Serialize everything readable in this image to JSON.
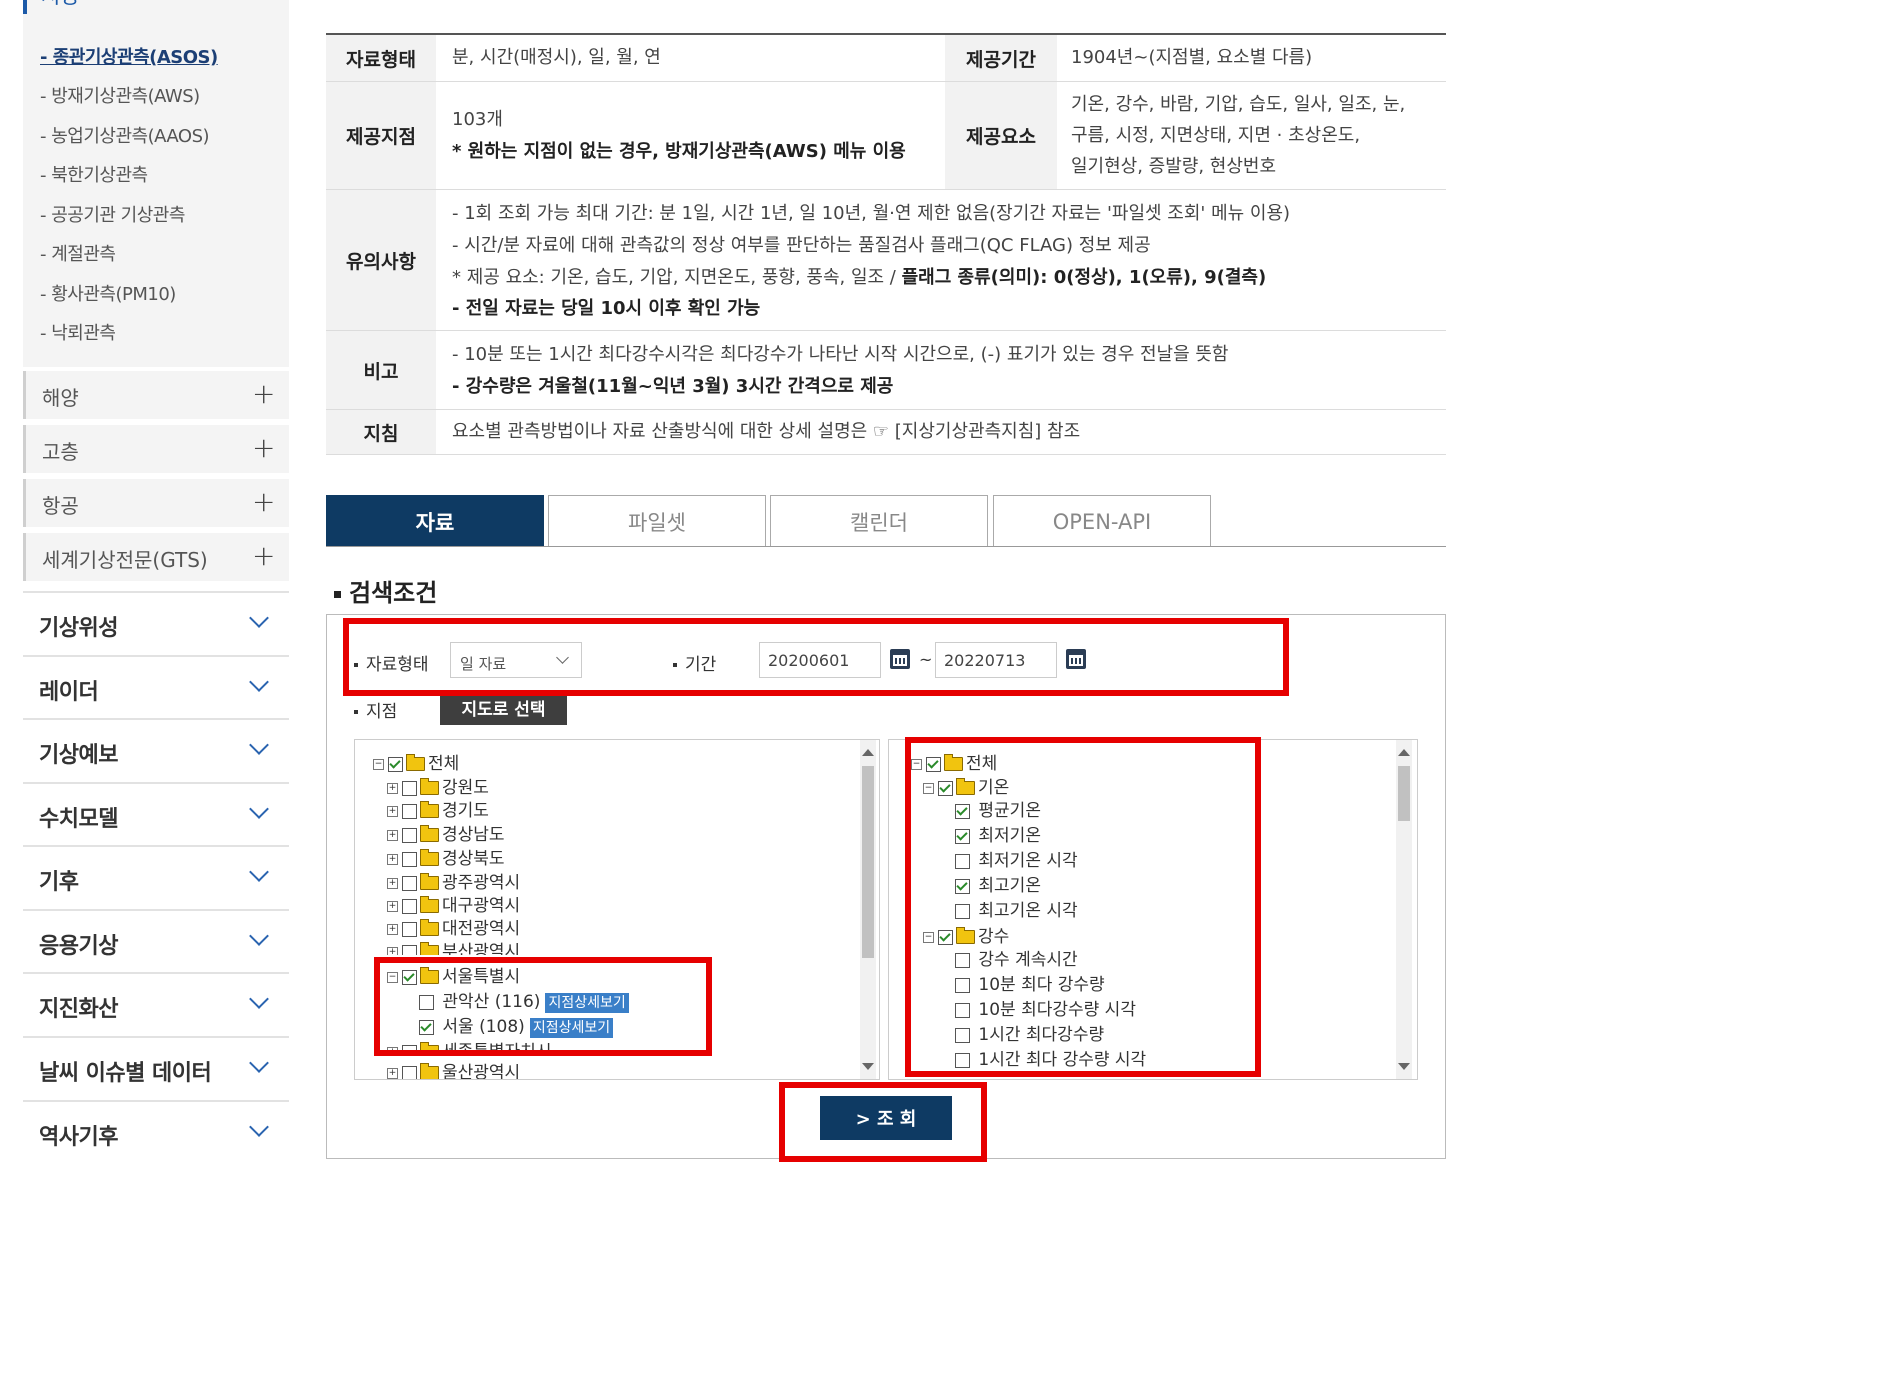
{
  "sidebar": {
    "section_title": "지상",
    "sub_items": [
      "- 종관기상관측(ASOS)",
      "- 방재기상관측(AWS)",
      "- 농업기상관측(AAOS)",
      "- 북한기상관측",
      "- 공공기관 기상관측",
      "- 계절관측",
      "- 황사관측(PM10)",
      "- 낙뢰관측"
    ],
    "mid_items": [
      "해양",
      "고층",
      "항공",
      "세계기상전문(GTS)"
    ],
    "main_items": [
      "기상위성",
      "레이더",
      "기상예보",
      "수치모델",
      "기후",
      "응용기상",
      "지진화산",
      "날씨 이슈별 데이터",
      "역사기후"
    ]
  },
  "info_table": {
    "row1": {
      "h1": "자료형태",
      "v1": "분, 시간(매정시), 일, 월, 연",
      "h2": "제공기간",
      "v2": "1904년~(지점별, 요소별 다름)"
    },
    "row2": {
      "h1": "제공지점",
      "v1a": "103개",
      "v1b": "* 원하는 지점이 없는 경우, 방재기상관측(AWS) 메뉴 이용",
      "h2": "제공요소",
      "v2a": "기온, 강수, 바람, 기압, 습도, 일사, 일조, 눈,",
      "v2b": "구름, 시정, 지면상태, 지면 · 초상온도,",
      "v2c": "일기현상, 증발량, 현상번호"
    },
    "row3": {
      "h": "유의사항",
      "l1": "- 1회 조회 가능 최대 기간: 분 1일, 시간 1년, 일 10년, 월·연 제한 없음(장기간 자료는 '파일셋 조회' 메뉴 이용)",
      "l2": "- 시간/분 자료에 대해 관측값의 정상 여부를 판단하는 품질검사 플래그(QC FLAG) 정보 제공",
      "l3a": "* 제공 요소: 기온, 습도, 기압, 지면온도, 풍향, 풍속, 일조 / ",
      "l3b": "플래그 종류(의미): 0(정상), 1(오류), 9(결측)",
      "l4": "- 전일 자료는 당일 10시 이후 확인 가능"
    },
    "row4": {
      "h": "비고",
      "l1": "- 10분 또는 1시간 최다강수시각은 최다강수가 나타난 시작 시간으로, (-) 표기가 있는 경우 전날을 뜻함",
      "l2": "- 강수량은 겨울철(11월~익년 3월) 3시간 간격으로 제공"
    },
    "row5": {
      "h": "지침",
      "v": "요소별 관측방법이나 자료 산출방식에 대한 상세 설명은 ☞ [지상기상관측지침] 참조"
    }
  },
  "tabs": [
    "자료",
    "파일셋",
    "캘린더",
    "OPEN-API"
  ],
  "search": {
    "title": "검색조건",
    "data_type_label": "자료형태",
    "data_type_value": "일 자료",
    "period_label": "기간",
    "start_date": "20200601",
    "tilde": "~",
    "end_date": "20220713",
    "station_label": "지점",
    "map_button": "지도로 선택",
    "query_button": "> 조 회"
  },
  "station_tree": {
    "root": "전체",
    "regions": [
      "강원도",
      "경기도",
      "경상남도",
      "경상북도",
      "광주광역시",
      "대구광역시",
      "대전광역시",
      "부산광역시"
    ],
    "seoul": "서울특별시",
    "stations": [
      {
        "name": "관악산 (116)",
        "checked": false,
        "detail": "지점상세보기"
      },
      {
        "name": "서울 (108)",
        "checked": true,
        "detail": "지점상세보기"
      }
    ],
    "after": [
      "세종특별자치시",
      "울산광역시"
    ]
  },
  "element_tree": {
    "root": "전체",
    "temp_group": "기온",
    "temp_items": [
      {
        "name": "평균기온",
        "checked": true
      },
      {
        "name": "최저기온",
        "checked": true
      },
      {
        "name": "최저기온 시각",
        "checked": false
      },
      {
        "name": "최고기온",
        "checked": true
      },
      {
        "name": "최고기온 시각",
        "checked": false
      }
    ],
    "rain_group": "강수",
    "rain_items": [
      {
        "name": "강수 계속시간",
        "checked": false
      },
      {
        "name": "10분 최다 강수량",
        "checked": false
      },
      {
        "name": "10분 최다강수량 시각",
        "checked": false
      },
      {
        "name": "1시간 최다강수량",
        "checked": false
      },
      {
        "name": "1시간 최다 강수량 시각",
        "checked": false
      }
    ]
  },
  "colors": {
    "accent_navy": "#0e3a63",
    "link_blue": "#1c5aa8",
    "highlight_red": "#e60000",
    "check_green": "#2a8a2a"
  }
}
